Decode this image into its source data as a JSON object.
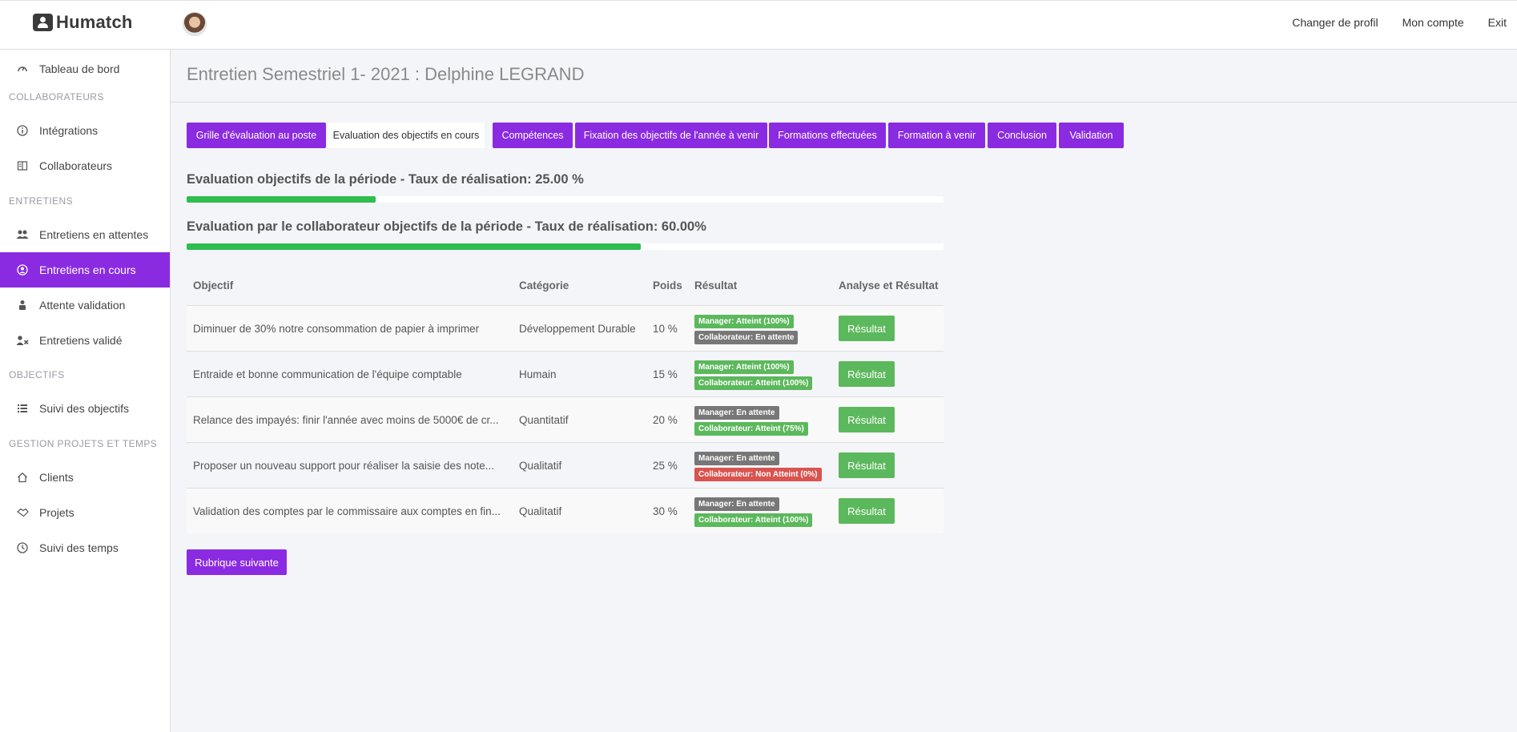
{
  "brand": {
    "name": "Humatch"
  },
  "topnav": {
    "links": [
      "Changer de profil",
      "Mon compte",
      "Exit"
    ]
  },
  "sidebar": {
    "tableau": "Tableau de bord",
    "sections": {
      "collaborateurs": "COLLABORATEURS",
      "entretiens": "ENTRETIENS",
      "objectifs": "OBJECTIFS",
      "gestion": "GESTION PROJETS ET TEMPS"
    },
    "items": {
      "integrations": "Intégrations",
      "collaborateurs": "Collaborateurs",
      "attentes": "Entretiens en attentes",
      "en_cours": "Entretiens en cours",
      "attente_validation": "Attente validation",
      "valide": "Entretiens validé",
      "suivi_objectifs": "Suivi des objectifs",
      "clients": "Clients",
      "projets": "Projets",
      "suivi_temps": "Suivi des temps"
    },
    "active_item": "Entretiens en cours"
  },
  "page": {
    "title": "Entretien Semestriel 1- 2021 : Delphine LEGRAND"
  },
  "tabs": [
    "Grille d'évaluation au poste",
    "Evaluation des objectifs en cours",
    "Compétences",
    "Fixation des objectifs de l'année à venir",
    "Formations effectuées",
    "Formation à venir",
    "Conclusion",
    "Validation"
  ],
  "active_tab": "Evaluation des objectifs en cours",
  "progress": [
    {
      "label": "Evaluation objectifs de la période - Taux de réalisation: 25.00 %",
      "value": 0.25
    },
    {
      "label": "Evaluation par le collaborateur objectifs de la période - Taux de réalisation: 60.00%",
      "value": 0.6
    }
  ],
  "table": {
    "headers": {
      "objectif": "Objectif",
      "categorie": "Catégorie",
      "poids": "Poids",
      "resultat": "Résultat",
      "analyse": "Analyse et Résultat"
    },
    "rows": [
      {
        "objectif": "Diminuer de 30% notre consommation de papier à imprimer",
        "categorie": "Développement Durable",
        "poids": "10 %",
        "manager": "Manager: Atteint (100%)",
        "manager_status": "success",
        "collab": "Collaborateur: En attente",
        "collab_status": "default",
        "button": "Résultat"
      },
      {
        "objectif": "Entraide et bonne communication de l'équipe comptable",
        "categorie": "Humain",
        "poids": "15 %",
        "manager": "Manager: Atteint (100%)",
        "manager_status": "success",
        "collab": "Collaborateur: Atteint (100%)",
        "collab_status": "success",
        "button": "Résultat"
      },
      {
        "objectif": "Relance des impayés: finir l'année avec moins de 5000€ de cr...",
        "categorie": "Quantitatif",
        "poids": "20 %",
        "manager": "Manager: En attente",
        "manager_status": "default",
        "collab": "Collaborateur: Atteint (75%)",
        "collab_status": "success",
        "button": "Résultat"
      },
      {
        "objectif": "Proposer un nouveau support pour réaliser la saisie des note...",
        "categorie": "Qualitatif",
        "poids": "25 %",
        "manager": "Manager: En attente",
        "manager_status": "default",
        "collab": "Collaborateur: Non Atteint (0%)",
        "collab_status": "danger",
        "button": "Résultat"
      },
      {
        "objectif": "Validation des comptes par le commissaire aux comptes en fin...",
        "categorie": "Qualitatif",
        "poids": "30 %",
        "manager": "Manager: En attente",
        "manager_status": "default",
        "collab": "Collaborateur: Atteint (100%)",
        "collab_status": "success",
        "button": "Résultat"
      }
    ]
  },
  "next_button": "Rubrique suivante",
  "colors": {
    "accent": "#8a2be2",
    "success": "#5cb85c",
    "default": "#777777",
    "danger": "#d9534f",
    "progress": "#2ebd4e"
  }
}
